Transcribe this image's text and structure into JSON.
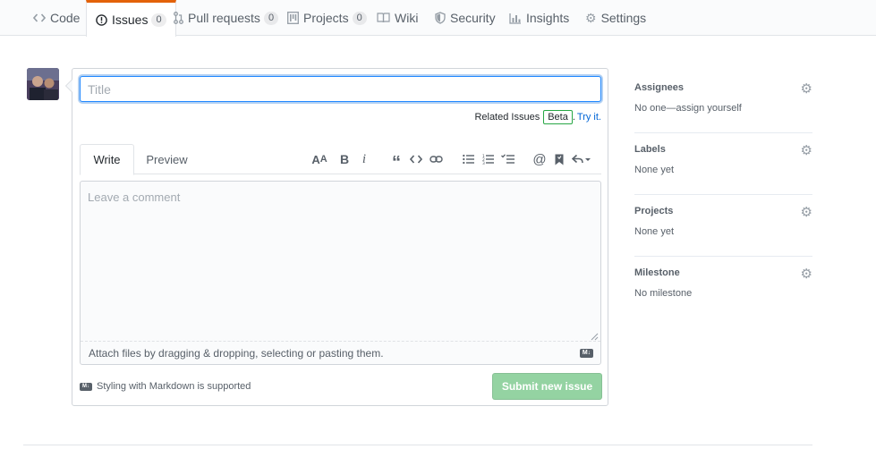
{
  "nav": {
    "tabs": [
      {
        "label": "Code",
        "icon": "code-icon",
        "count": null
      },
      {
        "label": "Issues",
        "icon": "issue-opened-icon",
        "count": "0"
      },
      {
        "label": "Pull requests",
        "icon": "git-pull-request-icon",
        "count": "0"
      },
      {
        "label": "Projects",
        "icon": "project-icon",
        "count": "0"
      },
      {
        "label": "Wiki",
        "icon": "book-icon",
        "count": null
      },
      {
        "label": "Security",
        "icon": "shield-icon",
        "count": null
      },
      {
        "label": "Insights",
        "icon": "graph-icon",
        "count": null
      },
      {
        "label": "Settings",
        "icon": "gear-icon",
        "count": null
      }
    ],
    "selected": "Issues"
  },
  "form": {
    "title_placeholder": "Title",
    "related_label": "Related Issues",
    "beta_label": "Beta",
    "try_label": "Try it.",
    "write_tab": "Write",
    "preview_tab": "Preview",
    "comment_placeholder": "Leave a comment",
    "attach_text": "Attach files by dragging & dropping, selecting or pasting them.",
    "markdown_note": "Styling with Markdown is supported",
    "submit_label": "Submit new issue"
  },
  "sidebar": {
    "sections": [
      {
        "label": "Assignees",
        "value": "No one—assign yourself"
      },
      {
        "label": "Labels",
        "value": "None yet"
      },
      {
        "label": "Projects",
        "value": "None yet"
      },
      {
        "label": "Milestone",
        "value": "No milestone"
      }
    ]
  },
  "colors": {
    "accent": "#e36209",
    "link": "#0366d6",
    "submit_disabled": "#94d3a2",
    "beta_border": "#28a745"
  }
}
